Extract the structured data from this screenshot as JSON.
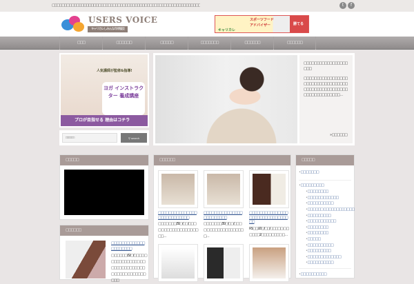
{
  "topbar": {
    "tagline": "□□□□□□□□□□□□□□□□□□□□□□□□□□□□□□□□□□□□□□□□□□□□□□□□□□□□□□□□□□□□□□□□□□□□□□",
    "social": [
      "twitter",
      "facebook"
    ]
  },
  "header": {
    "logo_title": "USERS VOICE",
    "logo_subtitle": "キャリカレしみんなの体験談",
    "banner": {
      "line1": "スポーツフード",
      "line2": "アドバイザー",
      "tag": "キャリカレ",
      "cta": "勝てる"
    }
  },
  "nav": [
    "□□□",
    "□□□□□□",
    "□□□□□",
    "□□□□□□□",
    "□□□□□□",
    "□□□□□□"
  ],
  "ad": {
    "headline": "ヨガ インストラクター 養成講座",
    "sub": "人気講師が監修&指導!",
    "cta": "プロが目指せる 理由はコチラ"
  },
  "search": {
    "placeholder": "□□□□□□",
    "button": "search"
  },
  "hero": {
    "title": "□□□□□□□□□□□□□□□□□□□□",
    "body": "□□□□□□□□□□□□□□□□□□□□□□□□□□□□□□□□□□□□□□□□□□□□□□□□□□□□□□□□□□□□□□□□□…",
    "more": "□□□□□□"
  },
  "left_box1": {
    "title": "□□□□□"
  },
  "left_box2": {
    "title": "□□□□□□",
    "item_title": "□□□□□□□□□□□□□□□□□□□□□",
    "item_desc": "□ □□□□□/32□/□□□□ □ □□□□□□□□□□□ □□ □□□□□□□□□□□□□□ □□□□□ □□□□□□□□□□"
  },
  "mid": {
    "title": "□□□□□□",
    "cards": [
      {
        "title": "□□□□□□□□□□□□□□□□□□□□□□□□□□□",
        "desc": "□□□□□□□/30□/□□/□□□□ □ □□□□□□□□□□□ □□□□…"
      },
      {
        "title": "□□□□□□□□□□□□□□□□□□□□□□□□",
        "desc": "□□□□□□□/30□/□□/□□□□ □ □□□□□□□□□□□□□ □…"
      },
      {
        "title": "□□□□□□□□□□□□□□□□□□□□□□□□□□□□□□□□",
        "desc": "R.S□□/20□/□□/□□□□□ □ □□□□□2□□□□□□□□ □…"
      },
      {
        "title": "",
        "desc": ""
      },
      {
        "title": "",
        "desc": ""
      },
      {
        "title": "",
        "desc": ""
      }
    ]
  },
  "right": {
    "title": "□□□□□",
    "top": [
      "□□□□□□□",
      "□□□□□□□□□"
    ],
    "sub": [
      "□□□□□□□□",
      "□□□□□□□□□□□□",
      "□□□□□□□□□□",
      "□□□□□□ □□□□□□□□□□□□",
      "□□□□□□□□□",
      "□□□□□□□□□□□",
      "□□□□□□□□",
      "□□□□□□□□",
      "□□□□□",
      "□□□□□□□□□□",
      "□□□□□□□□□",
      "□□□□□□□□□□□□□",
      "□□□□□□□□□□"
    ],
    "last": "□□□□□□□□□□"
  }
}
